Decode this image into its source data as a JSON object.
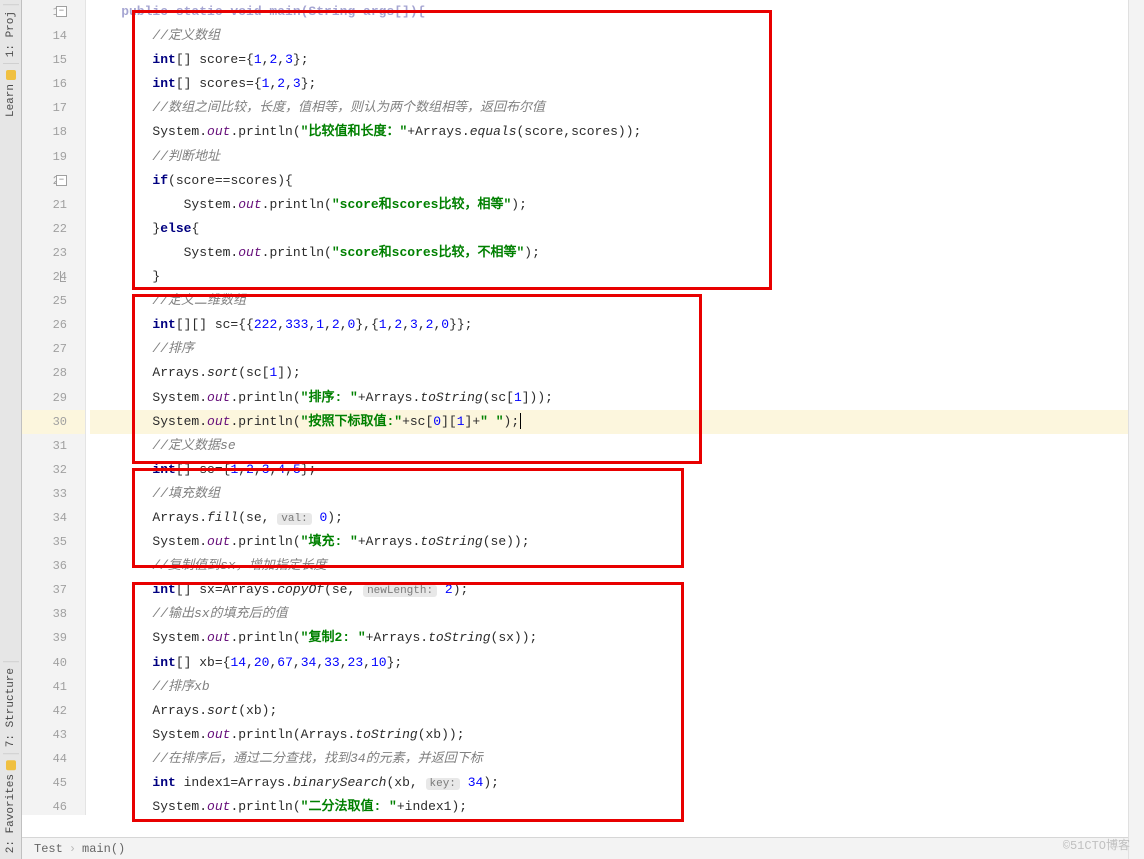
{
  "rail_tabs": [
    {
      "label": "1: Proj",
      "color": ""
    },
    {
      "label": "Learn",
      "color": "#f0c040"
    }
  ],
  "rail_tabs_bottom": [
    {
      "label": "7: Structure",
      "color": ""
    },
    {
      "label": "2: Favorites",
      "color": "#f0c040"
    }
  ],
  "line_numbers": [
    "13",
    "14",
    "15",
    "16",
    "17",
    "18",
    "19",
    "20",
    "21",
    "22",
    "23",
    "24",
    "25",
    "26",
    "27",
    "28",
    "29",
    "30",
    "31",
    "32",
    "33",
    "34",
    "35",
    "36",
    "37",
    "38",
    "39",
    "40",
    "41",
    "42",
    "43",
    "44",
    "45",
    "46"
  ],
  "highlight_line": "30",
  "breadcrumbs": [
    "Test",
    "main()"
  ],
  "watermark": "©51CTO博客",
  "code": {
    "l13_head": "    public static void main(String args[]){",
    "l14_cmt": "//定义数组",
    "l15_a": "int",
    "l15_b": "[] score={",
    "l15_n1": "1",
    "l15_c": ",",
    "l15_n2": "2",
    "l15_n3": "3",
    "l15_d": "};",
    "l16_a": "int",
    "l16_b": "[] scores={",
    "l16_n1": "1",
    "l16_n2": "2",
    "l16_n3": "3",
    "l16_c": "};",
    "l17_cmt": "//数组之间比较，长度，值相等，则认为两个数组相等，返回布尔值",
    "l18_a": "System.",
    "l18_out": "out",
    "l18_b": ".println(",
    "l18_str": "\"比较值和长度：\"",
    "l18_c": "+Arrays.",
    "l18_eq": "equals",
    "l18_d": "(score,scores));",
    "l19_cmt": "//判断地址",
    "l20_if": "if",
    "l20_a": "(score==scores){",
    "l21_a": "System.",
    "l21_out": "out",
    "l21_b": ".println(",
    "l21_str": "\"score和scores比较，相等\"",
    "l21_c": ");",
    "l22_a": "}",
    "l22_else": "else",
    "l22_b": "{",
    "l23_a": "System.",
    "l23_out": "out",
    "l23_b": ".println(",
    "l23_str": "\"score和scores比较，不相等\"",
    "l23_c": ");",
    "l24": "}",
    "l25_cmt": "//定义二维数组",
    "l26_a": "int",
    "l26_b": "[][] sc={{",
    "l26_n1": "222",
    "l26_n2": "333",
    "l26_n3": "1",
    "l26_n4": "2",
    "l26_n5": "0",
    "l26_c": "},{",
    "l26_n6": "1",
    "l26_n7": "2",
    "l26_n8": "3",
    "l26_n9": "2",
    "l26_n10": "0",
    "l26_d": "}};",
    "l27_cmt": "//排序",
    "l28_a": "Arrays.",
    "l28_sort": "sort",
    "l28_b": "(sc[",
    "l28_n": "1",
    "l28_c": "]);",
    "l29_a": "System.",
    "l29_out": "out",
    "l29_b": ".println(",
    "l29_str": "\"排序: \"",
    "l29_c": "+Arrays.",
    "l29_ts": "toString",
    "l29_d": "(sc[",
    "l29_n": "1",
    "l29_e": "]));",
    "l30_a": "System.",
    "l30_out": "out",
    "l30_b": ".println(",
    "l30_str": "\"按照下标取值:\"",
    "l30_c": "+sc[",
    "l30_n1": "0",
    "l30_d": "][",
    "l30_n2": "1",
    "l30_e": "]+",
    "l30_str2": "\" \"",
    "l30_f": ");",
    "l31_cmt": "//定义数据se",
    "l32_a": "int",
    "l32_b": "[] se={",
    "l32_n1": "1",
    "l32_n2": "2",
    "l32_n3": "3",
    "l32_n4": "4",
    "l32_n5": "5",
    "l32_c": "};",
    "l33_cmt": "//填充数组",
    "l34_a": "Arrays.",
    "l34_fill": "fill",
    "l34_b": "(se, ",
    "l34_hint": "val:",
    "l34_sp": " ",
    "l34_n": "0",
    "l34_c": ");",
    "l35_a": "System.",
    "l35_out": "out",
    "l35_b": ".println(",
    "l35_str": "\"填充: \"",
    "l35_c": "+Arrays.",
    "l35_ts": "toString",
    "l35_d": "(se));",
    "l36_cmt": "//复制值到sx，增加指定长度",
    "l37_a": "int",
    "l37_b": "[] sx=Arrays.",
    "l37_co": "copyOf",
    "l37_c": "(se, ",
    "l37_hint": "newLength:",
    "l37_sp": " ",
    "l37_n": "2",
    "l37_d": ");",
    "l38_cmt": "//输出sx的填充后的值",
    "l39_a": "System.",
    "l39_out": "out",
    "l39_b": ".println(",
    "l39_str": "\"复制2: \"",
    "l39_c": "+Arrays.",
    "l39_ts": "toString",
    "l39_d": "(sx));",
    "l40_a": "int",
    "l40_b": "[] xb={",
    "l40_n1": "14",
    "l40_n2": "20",
    "l40_n3": "67",
    "l40_n4": "34",
    "l40_n5": "33",
    "l40_n6": "23",
    "l40_n7": "10",
    "l40_c": "};",
    "l41_cmt": "//排序xb",
    "l42_a": "Arrays.",
    "l42_sort": "sort",
    "l42_b": "(xb);",
    "l43_a": "System.",
    "l43_out": "out",
    "l43_b": ".println(Arrays.",
    "l43_ts": "toString",
    "l43_c": "(xb));",
    "l44_cmt": "//在排序后，通过二分查找，找到34的元素，并返回下标",
    "l45_a": "int",
    "l45_b": " index1=Arrays.",
    "l45_bs": "binarySearch",
    "l45_c": "(xb, ",
    "l45_hint": "key:",
    "l45_sp": " ",
    "l45_n": "34",
    "l45_d": ");",
    "l46_a": "System.",
    "l46_out": "out",
    "l46_b": ".println(",
    "l46_str": "\"二分法取值: \"",
    "l46_c": "+index1);"
  }
}
